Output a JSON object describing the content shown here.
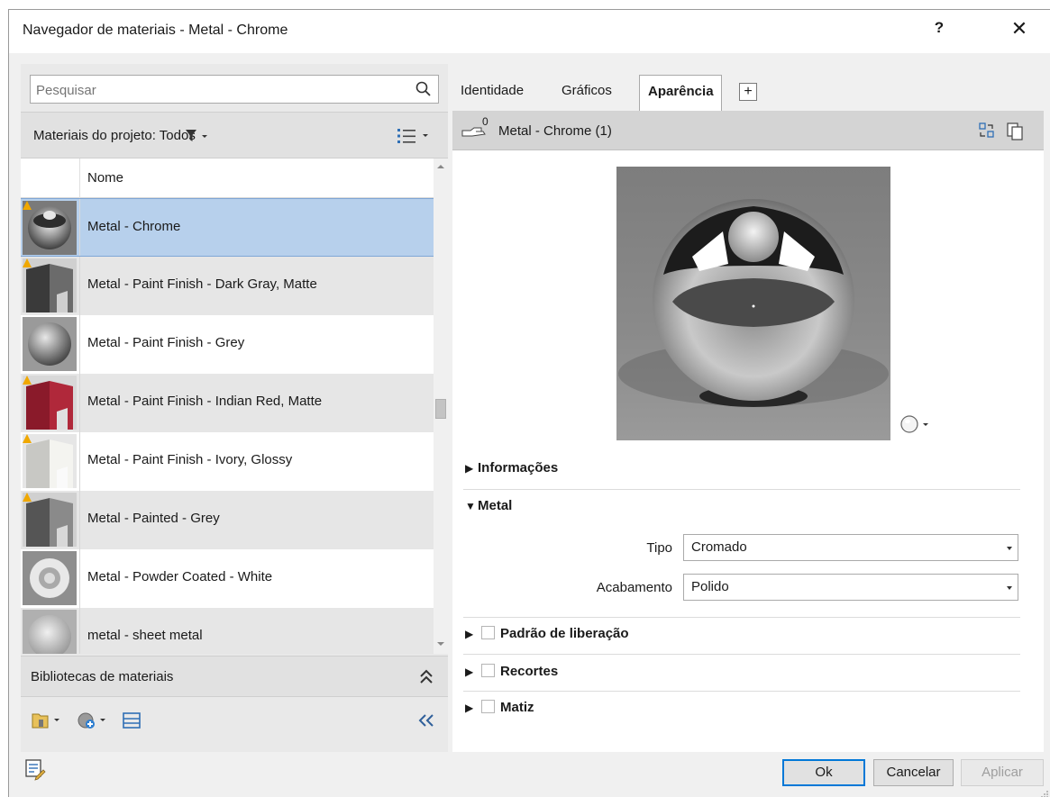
{
  "dialog": {
    "title": "Navegador de materiais - Metal - Chrome",
    "help_label": "?",
    "close_label": "✕"
  },
  "search": {
    "placeholder": "Pesquisar"
  },
  "project_materials": {
    "label": "Materiais do projeto: Todos"
  },
  "material_list": {
    "column_name": "Nome",
    "items": [
      {
        "name": "Metal - Chrome",
        "thumb": "chrome-sphere",
        "selected": true
      },
      {
        "name": "Metal - Paint Finish - Dark Gray, Matte",
        "thumb": "dark-gray-cube"
      },
      {
        "name": "Metal - Paint Finish - Grey",
        "thumb": "grey-sphere"
      },
      {
        "name": "Metal - Paint Finish - Indian Red, Matte",
        "thumb": "red-cube"
      },
      {
        "name": "Metal - Paint Finish - Ivory, Glossy",
        "thumb": "ivory-cube"
      },
      {
        "name": "Metal - Painted - Grey",
        "thumb": "grey-cube"
      },
      {
        "name": "Metal - Powder Coated - White",
        "thumb": "white-torus"
      },
      {
        "name": "metal - sheet metal",
        "thumb": "sheet-sphere"
      }
    ]
  },
  "libraries": {
    "label": "Bibliotecas de materiais"
  },
  "tabs": {
    "identity": "Identidade",
    "graphics": "Gráficos",
    "appearance": "Aparência",
    "add": "+"
  },
  "asset": {
    "count": "0",
    "name": "Metal - Chrome (1)"
  },
  "sections": {
    "info": "Informações",
    "metal": "Metal",
    "release_pattern": "Padrão de liberação",
    "cutouts": "Recortes",
    "tint": "Matiz"
  },
  "properties": {
    "type_label": "Tipo",
    "type_value": "Cromado",
    "finish_label": "Acabamento",
    "finish_value": "Polido"
  },
  "buttons": {
    "ok": "Ok",
    "cancel": "Cancelar",
    "apply": "Aplicar"
  },
  "colors": {
    "selection": "#b7d0ec",
    "ok_border": "#0078d7"
  }
}
